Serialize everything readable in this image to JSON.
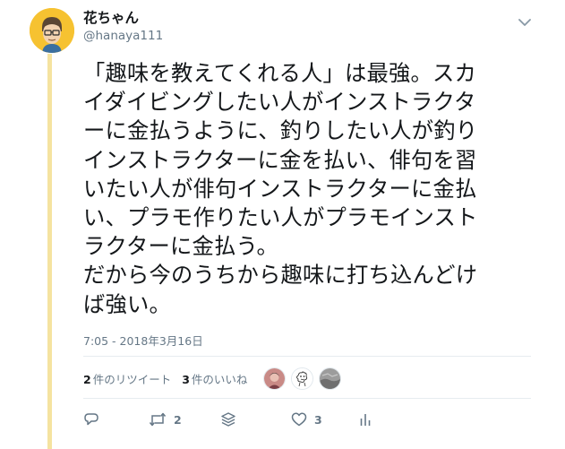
{
  "author": {
    "display_name": "花ちゃん",
    "handle": "@hanaya111"
  },
  "tweet": {
    "text": "「趣味を教えてくれる人」は最強。スカ\nイダイビングしたい人がインストラクタ\nーに金払うように、釣りしたい人が釣り\nインストラクターに金を払い、俳句を習\nいたい人が俳句インストラクターに金払\nい、プラモ作りたい人がプラモインスト\nラクターに金払う。\nだから今のうちから趣味に打ち込んどけ\nば強い。",
    "timestamp": "7:05 - 2018年3月16日"
  },
  "stats": {
    "retweets_count": "2",
    "retweets_label": "件のリツイート",
    "likes_count": "3",
    "likes_label": "件のいいね"
  },
  "likers": [
    {
      "icon": "liker-avatar-1"
    },
    {
      "icon": "liker-avatar-2"
    },
    {
      "icon": "liker-avatar-3"
    }
  ],
  "actions": {
    "reply_icon": "reply-icon",
    "retweet_icon": "retweet-icon",
    "retweet_count": "2",
    "stack_icon": "stack-icon",
    "like_icon": "heart-icon",
    "like_count": "3",
    "analytics_icon": "analytics-icon"
  },
  "colors": {
    "thread_line": "#f5e3a0",
    "avatar_bg": "#f6c231",
    "secondary_text": "#657786",
    "primary_text": "#14171a",
    "divider": "#e6ecf0"
  }
}
